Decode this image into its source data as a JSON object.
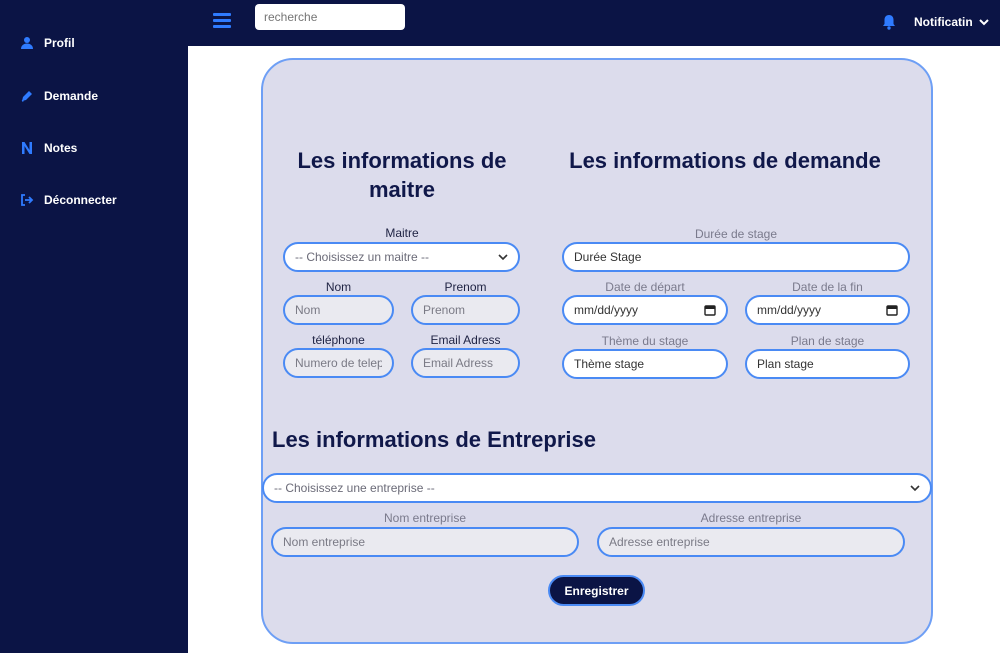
{
  "sidebar": {
    "items": [
      {
        "label": "Profil",
        "icon": "user-icon"
      },
      {
        "label": "Demande",
        "icon": "pen-icon"
      },
      {
        "label": "Notes",
        "icon": "n-icon"
      },
      {
        "label": "Déconnecter",
        "icon": "logout-icon"
      }
    ]
  },
  "topbar": {
    "search_placeholder": "recherche",
    "notifications_label": "Notificatin"
  },
  "maitre": {
    "title": "Les informations de maitre",
    "select_label": "Maitre",
    "select_value": "-- Choisissez un maitre --",
    "nom_label": "Nom",
    "nom_placeholder": "Nom",
    "prenom_label": "Prenom",
    "prenom_placeholder": "Prenom",
    "telephone_label": "téléphone",
    "telephone_placeholder": "Numero de telep",
    "email_label": "Email Adress",
    "email_placeholder": "Email Adress"
  },
  "demande": {
    "title": "Les informations de demande",
    "duree_label": "Durée de stage",
    "duree_placeholder": "Durée Stage",
    "date_depart_label": "Date de départ",
    "date_depart_value": "mm/dd/yyyy",
    "date_fin_label": "Date de la fin",
    "date_fin_value": "mm/dd/yyyy",
    "theme_label": "Thème du stage",
    "theme_placeholder": "Thème stage",
    "plan_label": "Plan de stage",
    "plan_placeholder": "Plan stage"
  },
  "entreprise": {
    "title": "Les informations de Entreprise",
    "select_value": "-- Choisissez une entreprise --",
    "nom_label": "Nom entreprise",
    "nom_placeholder": "Nom entreprise",
    "adresse_label": "Adresse entreprise",
    "adresse_placeholder": "Adresse entreprise"
  },
  "submit_label": "Enregistrer",
  "colors": {
    "sidebar_bg": "#0b1445",
    "accent": "#2f7bff",
    "card_bg": "#dcdcec",
    "input_border": "#4a8af4"
  }
}
